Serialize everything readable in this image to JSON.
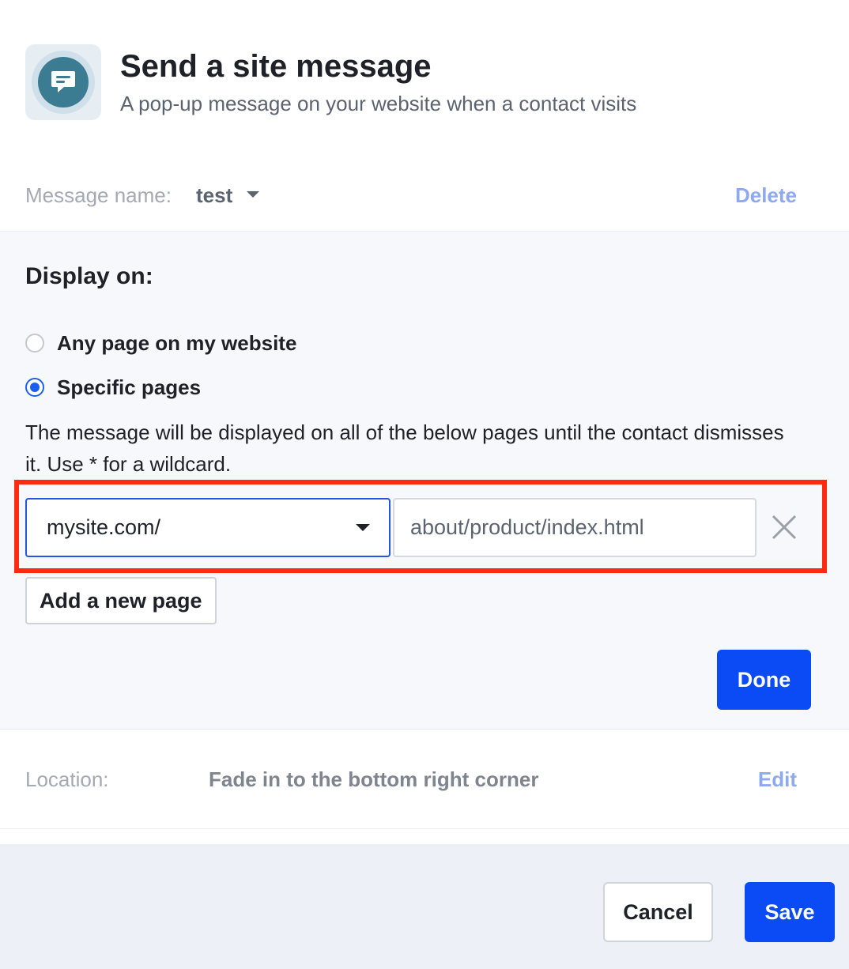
{
  "header": {
    "icon": "chat-message-icon",
    "title": "Send a site message",
    "subtitle": "A pop-up message on your website when a contact visits"
  },
  "message_name": {
    "label": "Message name:",
    "value": "test",
    "delete_label": "Delete"
  },
  "display_on": {
    "title": "Display on:",
    "options": [
      {
        "label": "Any page on my website",
        "selected": false
      },
      {
        "label": "Specific pages",
        "selected": true
      }
    ],
    "help_text": "The message will be displayed on all of the below pages until the contact dismisses it. Use * for a wildcard.",
    "pages": [
      {
        "domain": "mysite.com/",
        "path": "about/product/index.html"
      }
    ],
    "add_page_label": "Add a new page",
    "done_label": "Done"
  },
  "location": {
    "label": "Location:",
    "value": "Fade in to the bottom right corner",
    "edit_label": "Edit"
  },
  "footer": {
    "cancel_label": "Cancel",
    "save_label": "Save"
  },
  "colors": {
    "primary": "#0a4bf5",
    "link": "#8ea9f0",
    "highlight": "#ff2a0f",
    "icon_bg": "#3b7c93"
  }
}
